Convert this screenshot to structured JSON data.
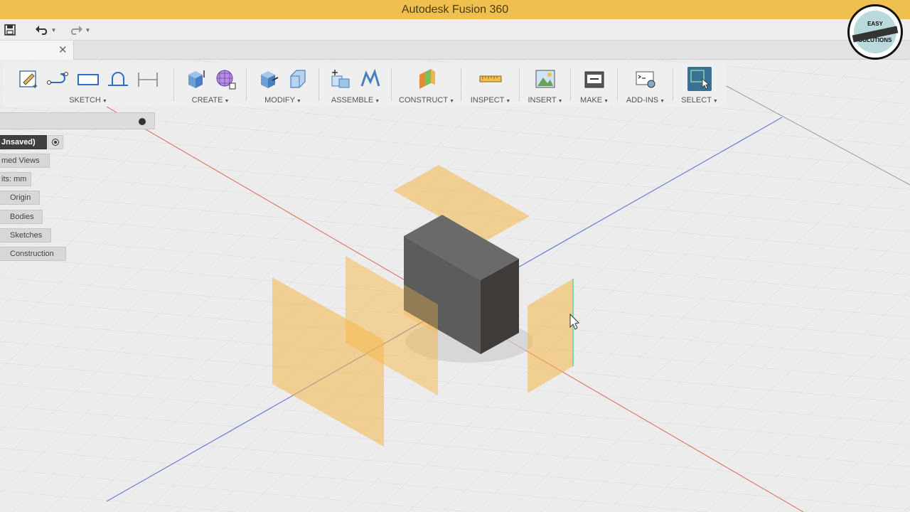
{
  "window": {
    "title": "Autodesk Fusion 360"
  },
  "toolbar": {
    "groups": [
      {
        "label": "SKETCH"
      },
      {
        "label": "CREATE"
      },
      {
        "label": "MODIFY"
      },
      {
        "label": "ASSEMBLE"
      },
      {
        "label": "CONSTRUCT"
      },
      {
        "label": "INSPECT"
      },
      {
        "label": "INSERT"
      },
      {
        "label": "MAKE"
      },
      {
        "label": "ADD-INS"
      },
      {
        "label": "SELECT"
      }
    ]
  },
  "browser": {
    "root": "Jnsaved)",
    "items": [
      {
        "label": "med Views"
      },
      {
        "label": "its: mm"
      },
      {
        "label": "Origin"
      },
      {
        "label": "Bodies"
      },
      {
        "label": "Sketches"
      },
      {
        "label": "Construction"
      }
    ]
  },
  "logo": {
    "line1": "EASY",
    "line2": "SOLUTIONS"
  },
  "colors": {
    "title_bar": "#f0c04e",
    "plane": "#f5b84a",
    "body": "#555555",
    "select_active": "#3c6f94"
  },
  "icons": {
    "save": "save-icon",
    "undo": "undo-icon",
    "redo": "redo-icon",
    "close_tab": "close-icon"
  }
}
